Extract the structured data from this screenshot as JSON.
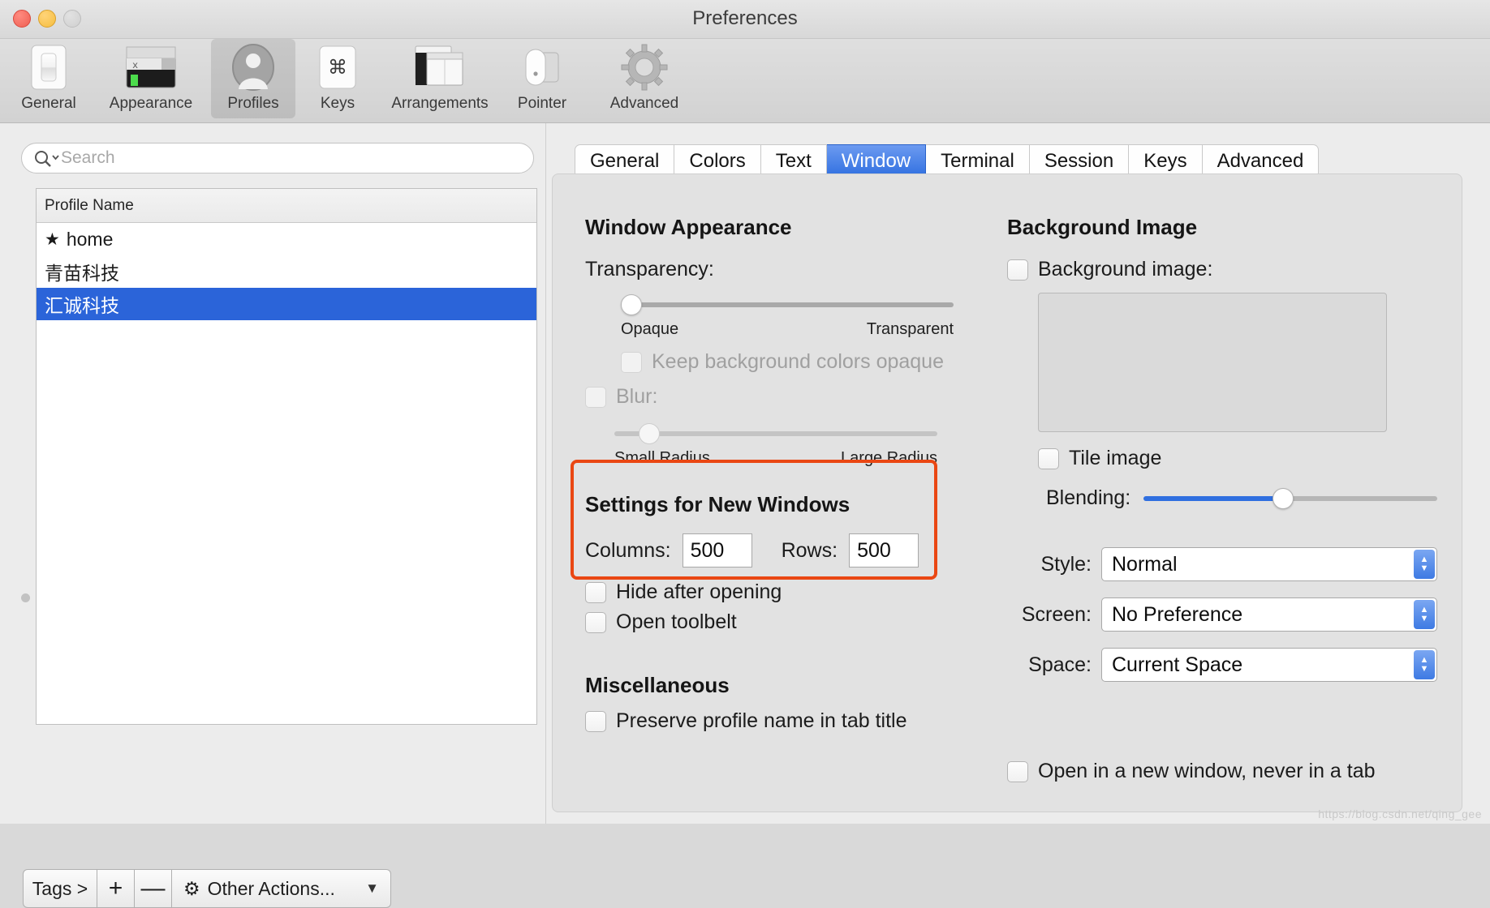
{
  "window": {
    "title": "Preferences",
    "traffic_lights": [
      "close",
      "minimize",
      "zoom"
    ]
  },
  "toolbar": {
    "items": [
      {
        "label": "General",
        "icon": "switch-icon",
        "selected": false
      },
      {
        "label": "Appearance",
        "icon": "terminal-window-icon",
        "selected": false
      },
      {
        "label": "Profiles",
        "icon": "user-silhouette-icon",
        "selected": true
      },
      {
        "label": "Keys",
        "icon": "command-key-icon",
        "selected": false
      },
      {
        "label": "Arrangements",
        "icon": "window-arrangement-icon",
        "selected": false
      },
      {
        "label": "Pointer",
        "icon": "mouse-icon",
        "selected": false
      },
      {
        "label": "Advanced",
        "icon": "gear-icon",
        "selected": false
      }
    ]
  },
  "sidebar": {
    "search": {
      "placeholder": "Search",
      "value": "",
      "icon": "search-icon"
    },
    "table": {
      "column_header": "Profile Name",
      "rows": [
        {
          "name": "home",
          "starred": true,
          "selected": false
        },
        {
          "name": "青苗科技",
          "starred": false,
          "selected": false
        },
        {
          "name": "汇诚科技",
          "starred": false,
          "selected": true
        }
      ]
    },
    "bottom_bar": {
      "tags_label": "Tags >",
      "add_label": "+",
      "remove_label": "—",
      "other_actions_label": "Other Actions...",
      "gear_icon": "gear-icon",
      "chevron_icon": "chevron-down-icon"
    }
  },
  "tabs": [
    {
      "label": "General",
      "active": false
    },
    {
      "label": "Colors",
      "active": false
    },
    {
      "label": "Text",
      "active": false
    },
    {
      "label": "Window",
      "active": true
    },
    {
      "label": "Terminal",
      "active": false
    },
    {
      "label": "Session",
      "active": false
    },
    {
      "label": "Keys",
      "active": false
    },
    {
      "label": "Advanced",
      "active": false
    }
  ],
  "window_tab": {
    "window_appearance": {
      "heading": "Window Appearance",
      "transparency_label": "Transparency:",
      "transparency_min": "Opaque",
      "transparency_max": "Transparent",
      "transparency_value": 0,
      "keep_bg_opaque_label": "Keep background colors opaque",
      "keep_bg_opaque_checked": false,
      "keep_bg_opaque_enabled": false,
      "blur_label": "Blur:",
      "blur_checked": false,
      "blur_enabled": false,
      "blur_min": "Small Radius",
      "blur_max": "Large Radius",
      "blur_value": 8
    },
    "settings_for_new_windows": {
      "heading": "Settings for New Windows",
      "columns_label": "Columns:",
      "columns_value": "500",
      "rows_label": "Rows:",
      "rows_value": "500",
      "hide_after_opening_label": "Hide after opening",
      "hide_after_opening_checked": false,
      "open_toolbelt_label": "Open toolbelt",
      "open_toolbelt_checked": false,
      "annotation_color": "#ea4713"
    },
    "miscellaneous": {
      "heading": "Miscellaneous",
      "preserve_profile_name_label": "Preserve profile name in tab title",
      "preserve_profile_name_checked": false
    },
    "background_image": {
      "heading": "Background Image",
      "background_image_label": "Background image:",
      "background_image_checked": false,
      "tile_image_label": "Tile image",
      "tile_image_checked": false,
      "blending_label": "Blending:",
      "blending_value": 45,
      "style_label": "Style:",
      "style_value": "Normal",
      "screen_label": "Screen:",
      "screen_value": "No Preference",
      "space_label": "Space:",
      "space_value": "Current Space",
      "open_new_window_label": "Open in a new window, never in a tab",
      "open_new_window_checked": false
    }
  },
  "colors": {
    "accent_blue": "#2f6fe0",
    "selection_blue": "#2b64d9",
    "annotation_red": "#ea4713"
  },
  "watermark": "https://blog.csdn.net/qing_gee"
}
